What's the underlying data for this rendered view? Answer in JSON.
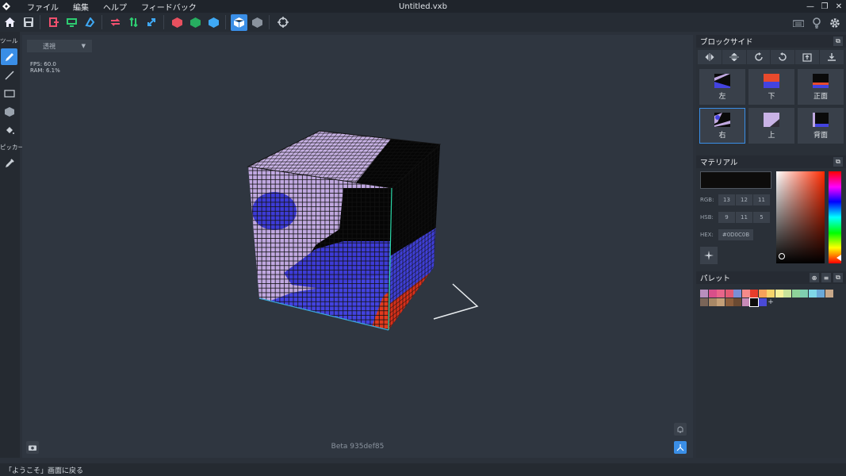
{
  "menubar": {
    "items": [
      "ファイル",
      "編集",
      "ヘルプ",
      "フィードバック"
    ],
    "title": "Untitled.vxb"
  },
  "toolbar": {
    "icons": [
      "home-icon",
      "save-icon",
      "import-icon",
      "export-icon",
      "share-icon",
      "swap-icon",
      "flip-icon",
      "transform-icon",
      "red-cube-icon",
      "green-cube-icon",
      "blue-cube-icon",
      "cube-outline-icon",
      "grey-cube-icon",
      "crosshair-icon"
    ],
    "right_icons": [
      "keyboard-icon",
      "lightbulb-icon",
      "gear-icon"
    ]
  },
  "left_tools": {
    "tools_label": "ツール",
    "picker_label": "ピッカー"
  },
  "viewport": {
    "projection": "透視",
    "fps": "FPS: 60.0",
    "ram": "RAM: 6.1%",
    "beta": "Beta 935def85"
  },
  "block_side": {
    "title": "ブロックサイド",
    "faces": [
      {
        "label": "左",
        "selected": false
      },
      {
        "label": "下",
        "selected": false
      },
      {
        "label": "正面",
        "selected": false
      },
      {
        "label": "右",
        "selected": true
      },
      {
        "label": "上",
        "selected": false
      },
      {
        "label": "背面",
        "selected": false
      }
    ]
  },
  "material": {
    "title": "マテリアル",
    "rgb_label": "RGB:",
    "rgb": [
      "13",
      "12",
      "11"
    ],
    "hsb_label": "HSB:",
    "hsb": [
      "9",
      "11",
      "5"
    ],
    "hex_label": "HEX:",
    "hex": "#0D0C0B",
    "color": "#0d0c0b"
  },
  "palette": {
    "title": "パレット",
    "colors": [
      "#b88fbd",
      "#d84f8a",
      "#e8658a",
      "#e25b74",
      "#7a8fd6",
      "#f58a8a",
      "#e63e2c",
      "#f6a25a",
      "#f7d46a",
      "#f8f19a",
      "#c8e39b",
      "#8fd39a",
      "#7fcfb0",
      "#7fd7e8",
      "#6aa8d8",
      "#c8a88a",
      "#7a6558",
      "#a88866",
      "#c4a078",
      "#8c5e3c",
      "#6b4a32",
      "#c88ab8",
      "#0d0c0b",
      "#4a4ad6"
    ],
    "add_label": "+"
  },
  "statusbar": {
    "text": "「ようこそ」画面に戻る"
  }
}
